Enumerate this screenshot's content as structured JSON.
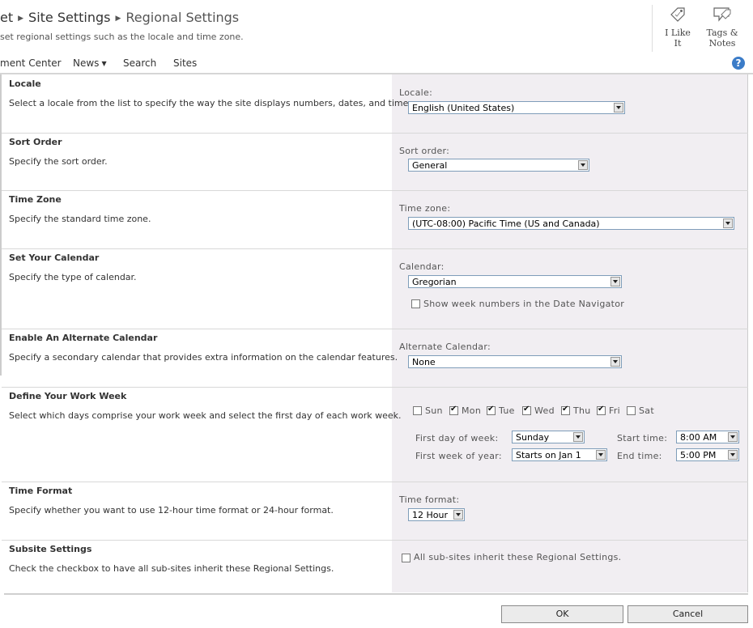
{
  "header": {
    "breadcrumb": [
      "et",
      "Site Settings",
      "Regional Settings"
    ],
    "subtitle": "set regional settings such as the locale and time zone.",
    "tools": {
      "i_like_it": "I Like It",
      "tags_notes_line1": "Tags &",
      "tags_notes_line2": "Notes"
    }
  },
  "nav": {
    "items": [
      "ment Center",
      "News",
      "Search",
      "Sites"
    ],
    "help": "?"
  },
  "sections": {
    "locale": {
      "title": "Locale",
      "desc": "Select a locale from the list to specify the way the site displays numbers, dates, and time.",
      "label": "Locale:",
      "value": "English (United States)"
    },
    "sort": {
      "title": "Sort Order",
      "desc": "Specify the sort order.",
      "label": "Sort order:",
      "value": "General"
    },
    "timezone": {
      "title": "Time Zone",
      "desc": "Specify the standard time zone.",
      "label": "Time zone:",
      "value": "(UTC-08:00) Pacific Time (US and Canada)"
    },
    "calendar": {
      "title": "Set Your Calendar",
      "desc": "Specify the type of calendar.",
      "label": "Calendar:",
      "value": "Gregorian",
      "week_numbers_label": "Show week numbers in the Date Navigator"
    },
    "altcal": {
      "title": "Enable An Alternate Calendar",
      "desc": "Specify a secondary calendar that provides extra information on the calendar features.",
      "label": "Alternate Calendar:",
      "value": "None"
    },
    "workweek": {
      "title": "Define Your Work Week",
      "desc": "Select which days comprise your work week and select the first day of each work week.",
      "days": [
        "Sun",
        "Mon",
        "Tue",
        "Wed",
        "Thu",
        "Fri",
        "Sat"
      ],
      "first_day_label": "First day of week:",
      "first_day_value": "Sunday",
      "first_week_label": "First week of year:",
      "first_week_value": "Starts on Jan 1",
      "start_label": "Start time:",
      "start_value": "8:00 AM",
      "end_label": "End time:",
      "end_value": "5:00 PM"
    },
    "timeformat": {
      "title": "Time Format",
      "desc": "Specify whether you want to use 12-hour time format or 24-hour format.",
      "label": "Time format:",
      "value": "12 Hour"
    },
    "subsite": {
      "title": "Subsite Settings",
      "desc": "Check the checkbox to have all sub-sites inherit these Regional Settings.",
      "checkbox_label": "All sub-sites inherit these Regional Settings."
    }
  },
  "buttons": {
    "ok": "OK",
    "cancel": "Cancel"
  }
}
